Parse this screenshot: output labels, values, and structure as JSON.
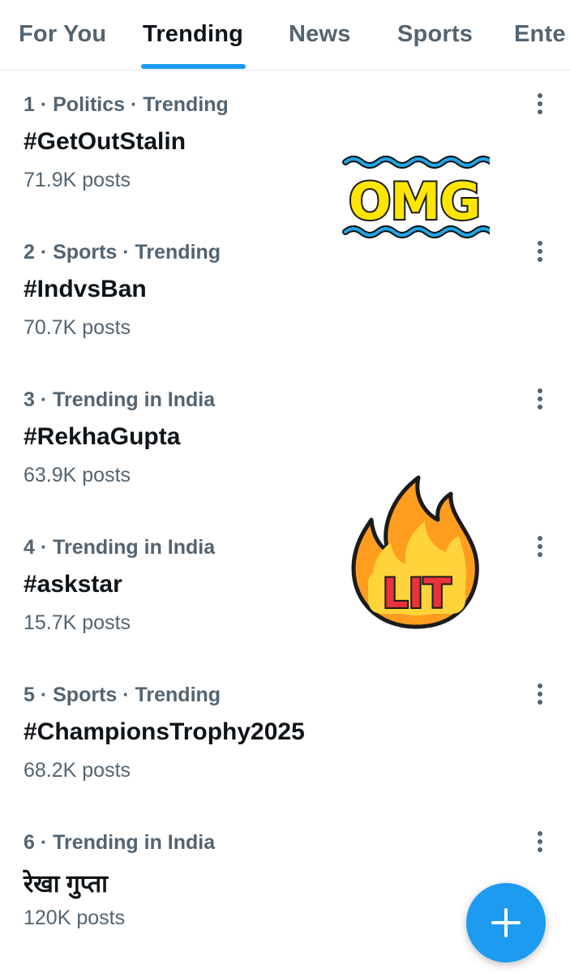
{
  "tabs": [
    {
      "label": "For You",
      "active": false
    },
    {
      "label": "Trending",
      "active": true
    },
    {
      "label": "News",
      "active": false
    },
    {
      "label": "Sports",
      "active": false
    },
    {
      "label": "Ente",
      "active": false
    }
  ],
  "trends": [
    {
      "meta": "1 · Politics · Trending",
      "tag": "#GetOutStalin",
      "posts": "71.9K posts"
    },
    {
      "meta": "2 · Sports · Trending",
      "tag": "#IndvsBan",
      "posts": "70.7K posts"
    },
    {
      "meta": "3 · Trending in India",
      "tag": "#RekhaGupta",
      "posts": "63.9K posts"
    },
    {
      "meta": "4 · Trending in India",
      "tag": "#askstar",
      "posts": "15.7K posts"
    },
    {
      "meta": "5 · Sports · Trending",
      "tag": "#ChampionsTrophy2025",
      "posts": "68.2K posts"
    },
    {
      "meta": "6 · Trending in India",
      "tag": "रेखा गुप्ता",
      "posts": "120K posts"
    }
  ],
  "stickers": {
    "omg": {
      "text": "OMG",
      "fill": "#ffe600",
      "waves": "#1ea7e4"
    },
    "lit": {
      "text": "LIT",
      "flame": "#ff9d1e",
      "inner": "#ffd43b",
      "text_color": "#e8333c"
    }
  },
  "icons": {
    "more": "more-vertical-icon",
    "compose": "plus-icon"
  },
  "colors": {
    "accent": "#1d9bf0",
    "secondary_text": "#536471",
    "primary_text": "#0f1419"
  }
}
